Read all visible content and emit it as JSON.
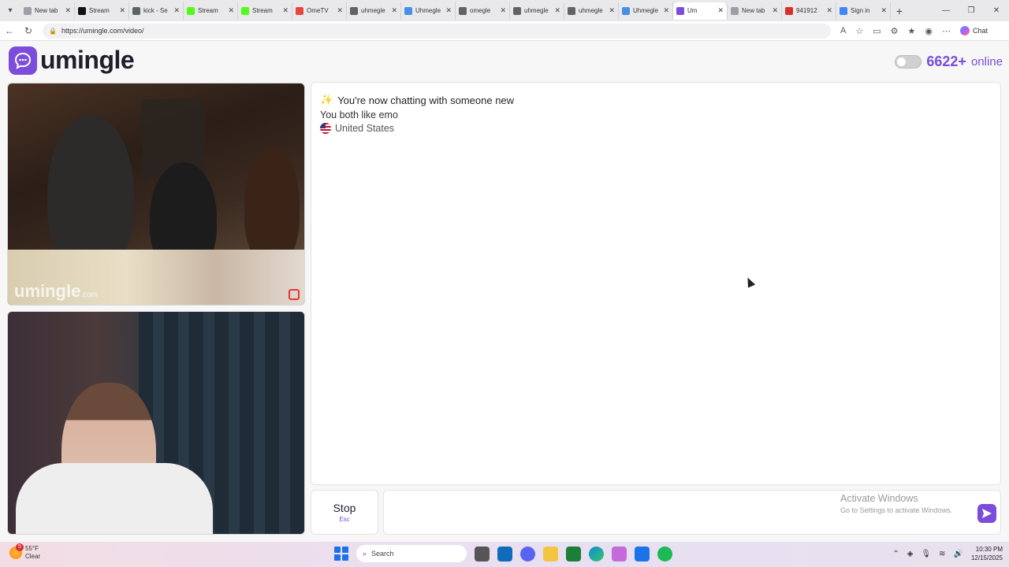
{
  "browser": {
    "tabs": [
      {
        "label": "New tab",
        "color": "#9aa0a6",
        "active": false
      },
      {
        "label": "Stream",
        "color": "#111111",
        "active": false
      },
      {
        "label": "kick - Se",
        "color": "#5f6368",
        "active": false
      },
      {
        "label": "Stream",
        "color": "#53fc18",
        "active": false
      },
      {
        "label": "Stream",
        "color": "#53fc18",
        "active": false
      },
      {
        "label": "OmeTV",
        "color": "#e8453c",
        "active": false
      },
      {
        "label": "uhmegle",
        "color": "#5f6368",
        "active": false
      },
      {
        "label": "Uhmegle",
        "color": "#4a90e2",
        "active": false
      },
      {
        "label": "omegle",
        "color": "#5f6368",
        "active": false
      },
      {
        "label": "uhmegle",
        "color": "#5f6368",
        "active": false
      },
      {
        "label": "uhmegle",
        "color": "#5f6368",
        "active": false
      },
      {
        "label": "Uhmegle",
        "color": "#4a90e2",
        "active": false
      },
      {
        "label": "Um",
        "color": "#7c4ddb",
        "active": true
      },
      {
        "label": "New tab",
        "color": "#9aa0a6",
        "active": false
      },
      {
        "label": "941912",
        "color": "#d93025",
        "active": false
      },
      {
        "label": "Sign in",
        "color": "#4285f4",
        "active": false
      }
    ],
    "url": "https://umingle.com/video/",
    "copilot_label": "Chat"
  },
  "site": {
    "brand": "umingle",
    "online_count": "6622+",
    "online_label": "online",
    "accent_color": "#7c4ddb"
  },
  "videos": {
    "watermark": "umingle",
    "watermark_suffix": ".com"
  },
  "chat": {
    "headline": "You're now chatting with someone new",
    "interests": "You both like emo",
    "country": "United States"
  },
  "controls": {
    "stop_label": "Stop",
    "stop_key": "Esc",
    "message_placeholder": ""
  },
  "activation": {
    "title": "Activate Windows",
    "subtitle": "Go to Settings to activate Windows."
  },
  "taskbar": {
    "weather_temp": "55°F",
    "weather_desc": "Clear",
    "weather_badge": "5",
    "search_label": "Search",
    "time": "10:30 PM",
    "date": "12/15/2025"
  }
}
